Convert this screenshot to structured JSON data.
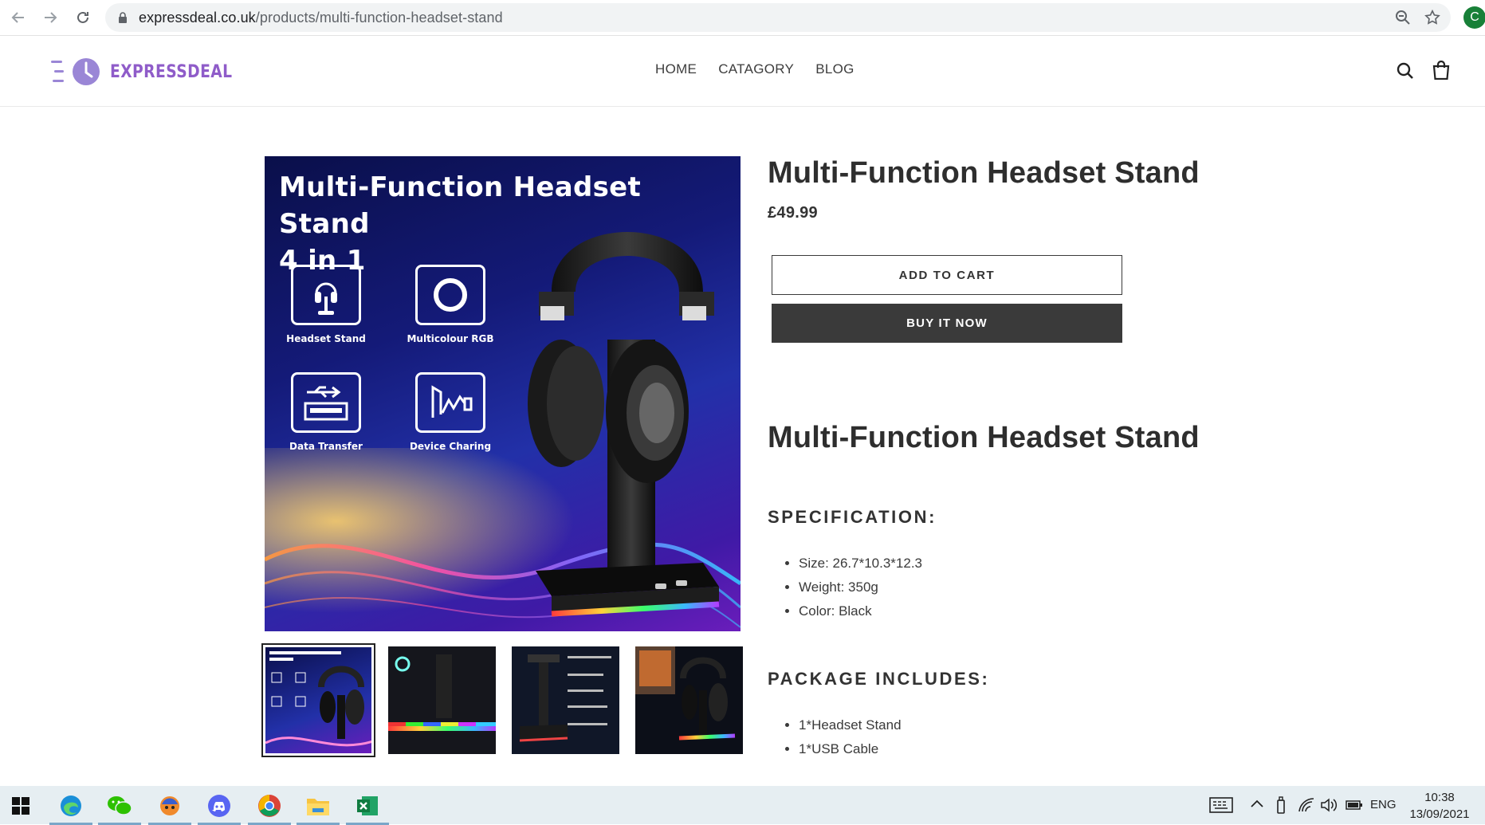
{
  "browser": {
    "url_domain": "expressdeal.co.uk",
    "url_path": "/products/multi-function-headset-stand",
    "profile_initial": "C"
  },
  "header": {
    "logo_text": "EXPRESSDEAL",
    "nav": [
      "HOME",
      "CATAGORY",
      "BLOG"
    ]
  },
  "media": {
    "image_title_line1": "Multi-Function Headset Stand",
    "image_title_line2": "4 in 1",
    "features": [
      "Headset Stand",
      "Multicolour RGB",
      "Data Transfer",
      "Device Charing"
    ]
  },
  "product": {
    "title": "Multi-Function Headset Stand",
    "price": "£49.99",
    "add_to_cart": "ADD TO CART",
    "buy_now": "BUY IT NOW"
  },
  "description": {
    "title": "Multi-Function Headset Stand",
    "spec_heading": "SPECIFICATION:",
    "specs": [
      "Size: 26.7*10.3*12.3",
      "Weight: 350g",
      "Color: Black"
    ],
    "package_heading": "PACKAGE INCLUDES:",
    "package": [
      "1*Headset Stand",
      "1*USB Cable"
    ]
  },
  "taskbar": {
    "language": "ENG",
    "time": "10:38",
    "date": "13/09/2021"
  },
  "colors": {
    "brand": "#8f5cc9",
    "button_dark": "#3a3a3a",
    "taskbar": "#e6eef2"
  }
}
